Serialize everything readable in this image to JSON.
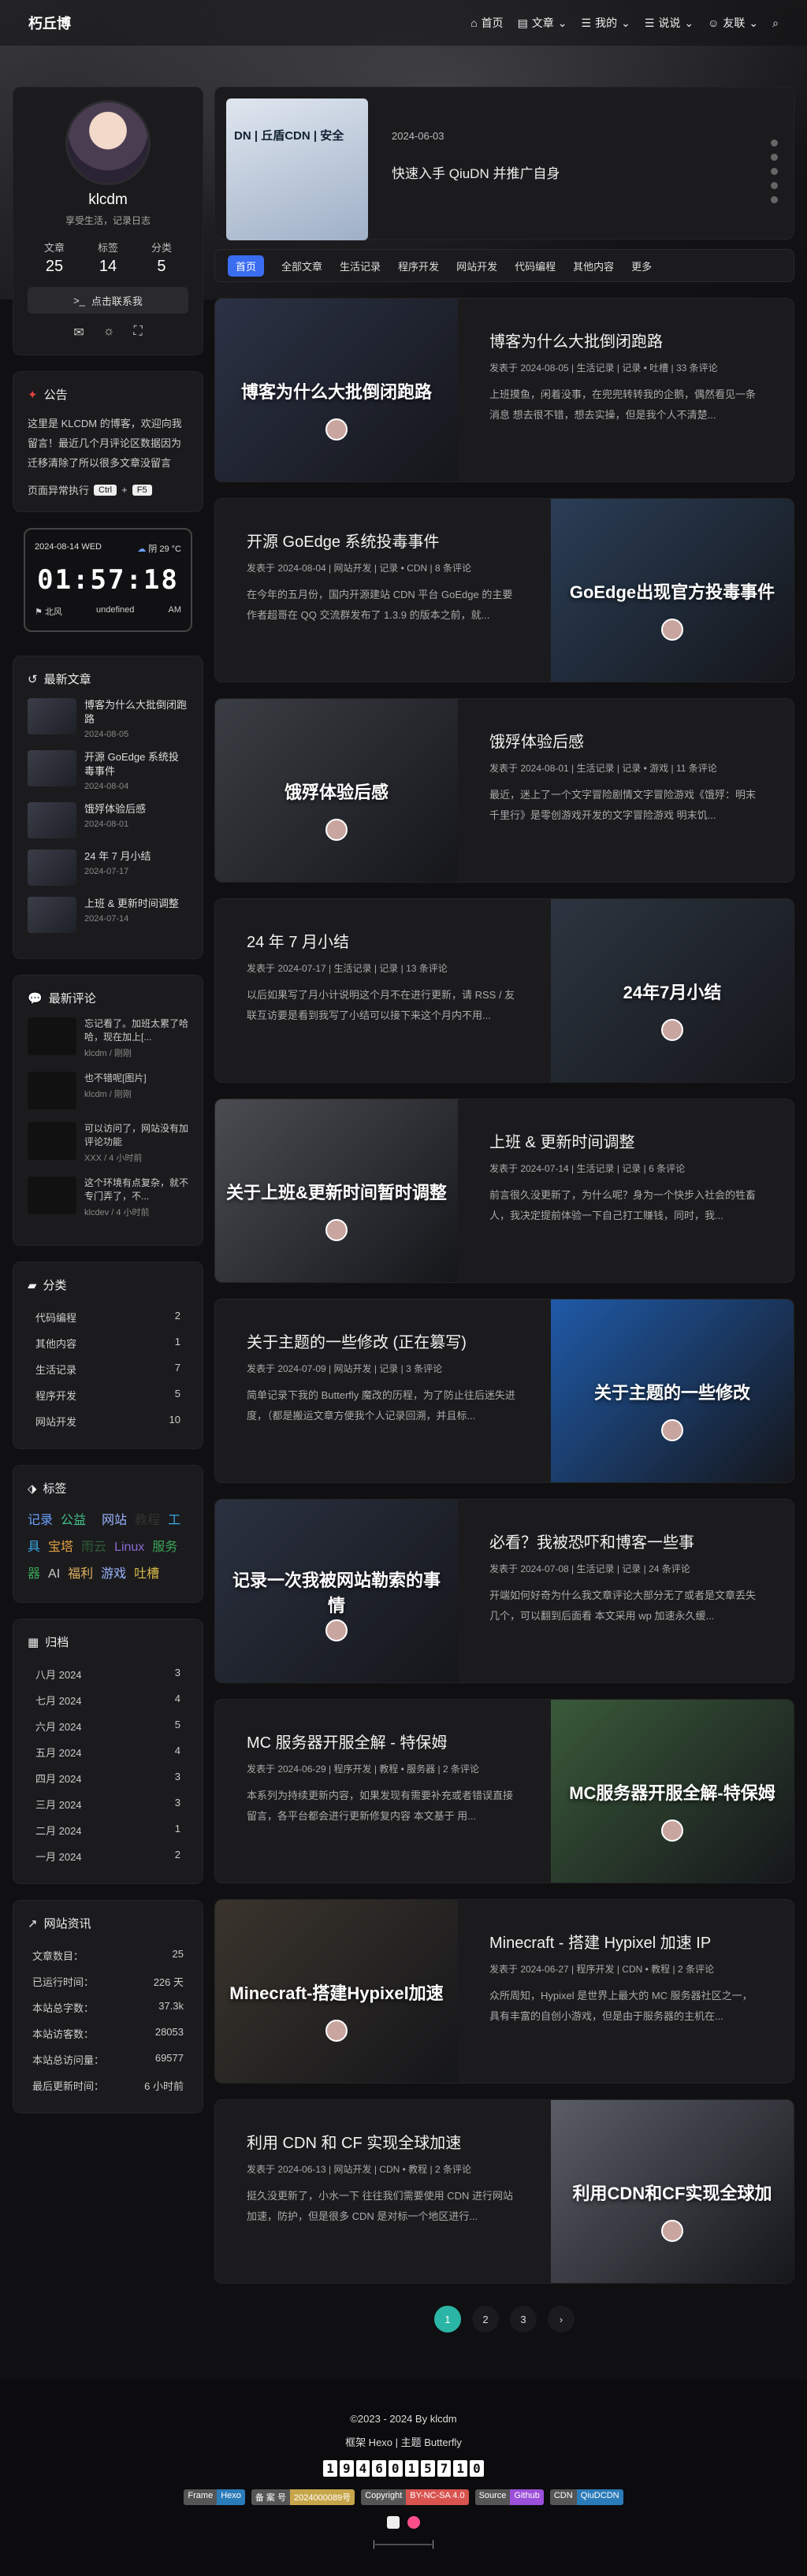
{
  "nav": {
    "brand": "朽丘博",
    "items": [
      {
        "icon": "home-icon",
        "label": "首页"
      },
      {
        "icon": "folder-icon",
        "label": "文章"
      },
      {
        "icon": "list-icon",
        "label": "我的"
      },
      {
        "icon": "list-icon",
        "label": "说说"
      },
      {
        "icon": "user-icon",
        "label": "友联"
      }
    ]
  },
  "profile": {
    "name": "klcdm",
    "desc": "享受生活，记录日志",
    "stats": [
      {
        "label": "文章",
        "value": "25"
      },
      {
        "label": "标签",
        "value": "14"
      },
      {
        "label": "分类",
        "value": "5"
      }
    ],
    "follow": "点击联系我"
  },
  "announcement": {
    "title": "公告",
    "text": "这里是 KLCDM 的博客，欢迎向我留言！最近几个月评论区数据因为迁移清除了所以很多文章没留言",
    "line_prefix": "页面异常执行",
    "key1": "Ctrl",
    "plus": "+",
    "key2": "F5"
  },
  "clock": {
    "date": "2024-08-14 WED",
    "weather": "阴 29 °C",
    "time": "01:57:18",
    "wind": "北风",
    "humidity": "undefined",
    "ampm": "AM"
  },
  "recent": {
    "title": "最新文章",
    "items": [
      {
        "title": "博客为什么大批倒闭跑路",
        "date": "2024-08-05"
      },
      {
        "title": "开源 GoEdge 系统投毒事件",
        "date": "2024-08-04"
      },
      {
        "title": "饿殍体验后感",
        "date": "2024-08-01"
      },
      {
        "title": "24 年 7 月小结",
        "date": "2024-07-17"
      },
      {
        "title": "上班 & 更新时间调整",
        "date": "2024-07-14"
      }
    ]
  },
  "comments": {
    "title": "最新评论",
    "items": [
      {
        "text": "忘记看了。加班太累了哈哈，现在加上[...",
        "by": "klcdm / 刚刚"
      },
      {
        "text": "也不错呢[图片]",
        "by": "klcdm / 刚刚"
      },
      {
        "text": "可以访问了，网站没有加评论功能",
        "by": "XXX / 4 小时前"
      },
      {
        "text": "这个环境有点复杂，就不专门弄了，不...",
        "by": "klcdev / 4 小时前"
      }
    ]
  },
  "categories": {
    "title": "分类",
    "items": [
      {
        "name": "代码编程",
        "count": "2"
      },
      {
        "name": "其他内容",
        "count": "1"
      },
      {
        "name": "生活记录",
        "count": "7"
      },
      {
        "name": "程序开发",
        "count": "5"
      },
      {
        "name": "网站开发",
        "count": "10"
      }
    ]
  },
  "tags": {
    "title": "标签",
    "items": [
      {
        "name": "记录",
        "color": "#6aa0ff"
      },
      {
        "name": "公益",
        "color": "#43c08a"
      },
      {
        "name": "",
        "color": "#d84a8a"
      },
      {
        "name": "网站",
        "color": "#9ab3ff"
      },
      {
        "name": "教程",
        "color": "#333333"
      },
      {
        "name": "工具",
        "color": "#3aa6e8"
      },
      {
        "name": "宝塔",
        "color": "#e0a040"
      },
      {
        "name": "雨云",
        "color": "#2f5c3a"
      },
      {
        "name": "Linux",
        "color": "#8a6ad6"
      },
      {
        "name": "服务器",
        "color": "#3aa65a"
      },
      {
        "name": "AI",
        "color": "#cccccc"
      },
      {
        "name": "福利",
        "color": "#e0b060"
      },
      {
        "name": "游戏",
        "color": "#9ab3ff"
      },
      {
        "name": "吐槽",
        "color": "#d6b94a"
      }
    ]
  },
  "archive": {
    "title": "归档",
    "items": [
      {
        "month": "八月 2024",
        "count": "3"
      },
      {
        "month": "七月 2024",
        "count": "4"
      },
      {
        "month": "六月 2024",
        "count": "5"
      },
      {
        "month": "五月 2024",
        "count": "4"
      },
      {
        "month": "四月 2024",
        "count": "3"
      },
      {
        "month": "三月 2024",
        "count": "3"
      },
      {
        "month": "二月 2024",
        "count": "1"
      },
      {
        "month": "一月 2024",
        "count": "2"
      }
    ]
  },
  "siteinfo": {
    "title": "网站资讯",
    "items": [
      {
        "label": "文章数目：",
        "value": "25"
      },
      {
        "label": "已运行时间：",
        "value": "226 天"
      },
      {
        "label": "本站总字数：",
        "value": "37.3k"
      },
      {
        "label": "本站访客数：",
        "value": "28053"
      },
      {
        "label": "本站总访问量：",
        "value": "69577"
      },
      {
        "label": "最后更新时间：",
        "value": "6 小时前"
      }
    ]
  },
  "pinned": {
    "image_text": "DN | 丘盾CDN | 安全",
    "date": "2024-06-03",
    "title": "快速入手 QiuDN 并推广自身"
  },
  "catbar": [
    "首页",
    "全部文章",
    "生活记录",
    "程序开发",
    "网站开发",
    "代码编程",
    "其他内容",
    "更多"
  ],
  "posts": [
    {
      "title": "博客为什么大批倒闭跑路",
      "cover": "博客为什么大批倒闭跑路",
      "meta": "发表于 2024-08-05 | 生活记录 | 记录 • 吐槽 | 33 条评论",
      "excerpt": "上班摸鱼，闲着没事，在兜兜转转我的企鹅，偶然看见一条消息 想去很不错，想去实操，但是我个人不清楚...",
      "color": "#2b3245"
    },
    {
      "title": "开源 GoEdge 系统投毒事件",
      "cover": "GoEdge出现官方投毒事件",
      "meta": "发表于 2024-08-04 | 网站开发 | 记录 • CDN | 8 条评论",
      "excerpt": "在今年的五月份，国内开源建站 CDN 平台 GoEdge 的主要作者超哥在 QQ 交流群发布了 1.3.9 的版本之前，就...",
      "color": "#2a3e56"
    },
    {
      "title": "饿殍体验后感",
      "cover": "饿殍体验后感",
      "meta": "发表于 2024-08-01 | 生活记录 | 记录 • 游戏 | 11 条评论",
      "excerpt": "最近，迷上了一个文字冒险剧情文字冒险游戏《饿殍：明末千里行》是零创游戏开发的文字冒险游戏 明末饥...",
      "color": "#3b3d44"
    },
    {
      "title": "24 年 7 月小结",
      "cover": "24年7月小结",
      "meta": "发表于 2024-07-17 | 生活记录 | 记录 | 13 条评论",
      "excerpt": "以后如果写了月小计说明这个月不在进行更新，请 RSS / 友联互访要是看到我写了小结可以接下来这个月内不用...",
      "color": "#2c3540"
    },
    {
      "title": "上班 & 更新时间调整",
      "cover": "关于上班&更新时间暂时调整",
      "meta": "发表于 2024-07-14 | 生活记录 | 记录 | 6 条评论",
      "excerpt": "前言很久没更新了，为什么呢？身为一个快步入社会的牲畜人，我决定提前体验一下自己打工赚钱，同时，我...",
      "color": "#4a4c52"
    },
    {
      "title": "关于主题的一些修改 (正在篡写)",
      "cover": "关于主题的一些修改",
      "meta": "发表于 2024-07-09 | 网站开发 | 记录 | 3 条评论",
      "excerpt": "简单记录下我的 Butterfly 魔改的历程，为了防止往后迷失进度，（都是搬运文章方便我个人记录回溯，并且标...",
      "color": "#1f5aa8"
    },
    {
      "title": "必看？我被恐吓和博客一些事",
      "cover": "记录一次我被网站勒索的事情",
      "meta": "发表于 2024-07-08 | 生活记录 | 记录 | 24 条评论",
      "excerpt": "开端如何好奇为什么我文章评论大部分无了或者是文章丢失几个，可以翻到后面看 本文采用 wp 加速永久缓...",
      "color": "#2a3140"
    },
    {
      "title": "MC 服务器开服全解 - 特保姆",
      "cover": "MC服务器开服全解-特保姆",
      "meta": "发表于 2024-06-29 | 程序开发 | 教程 • 服务器 | 2 条评论",
      "excerpt": "本系列为持续更新内容，如果发现有需要补充或者错误直接留言，各平台都会进行更新修复内容 本文基于 用...",
      "color": "#3a5a3a"
    },
    {
      "title": "Minecraft - 搭建 Hypixel 加速 IP",
      "cover": "Minecraft-搭建Hypixel加速",
      "meta": "发表于 2024-06-27 | 程序开发 | CDN • 教程 | 2 条评论",
      "excerpt": "众所周知，Hypixel 是世界上最大的 MC 服务器社区之一，具有丰富的自创小游戏，但是由于服务器的主机在...",
      "color": "#3a342c"
    },
    {
      "title": "利用 CDN 和 CF 实现全球加速",
      "cover": "利用CDN和CF实现全球加",
      "meta": "发表于 2024-06-13 | 网站开发 | CDN • 教程 | 2 条评论",
      "excerpt": "挺久没更新了，小水一下 往往我们需要使用 CDN 进行网站加速，防护，但是很多 CDN 是对标一个地区进行...",
      "color": "#5a5c66"
    }
  ],
  "pager": [
    "1",
    "2",
    "3",
    "›"
  ],
  "footer": {
    "copyright": "©2023 - 2024 By klcdm",
    "framework": "框架 Hexo | 主题 Butterfly",
    "counter": [
      "1",
      "9",
      "4",
      "6",
      "0",
      "1",
      "5",
      "7",
      "1",
      "0"
    ],
    "badges": [
      {
        "left": "Frame",
        "right": "Hexo",
        "color": "#2b7bb9"
      },
      {
        "left": "备 案 号",
        "right": "2024000089号",
        "color": "#c7a54a"
      },
      {
        "left": "Copyright",
        "right": "BY-NC-SA 4.0",
        "color": "#d9534f"
      },
      {
        "left": "Source",
        "right": "Github",
        "color": "#9c4fd9"
      },
      {
        "left": "CDN",
        "right": "QiuDCDN",
        "color": "#2b7bb9"
      }
    ],
    "bottom": "|——————|"
  }
}
